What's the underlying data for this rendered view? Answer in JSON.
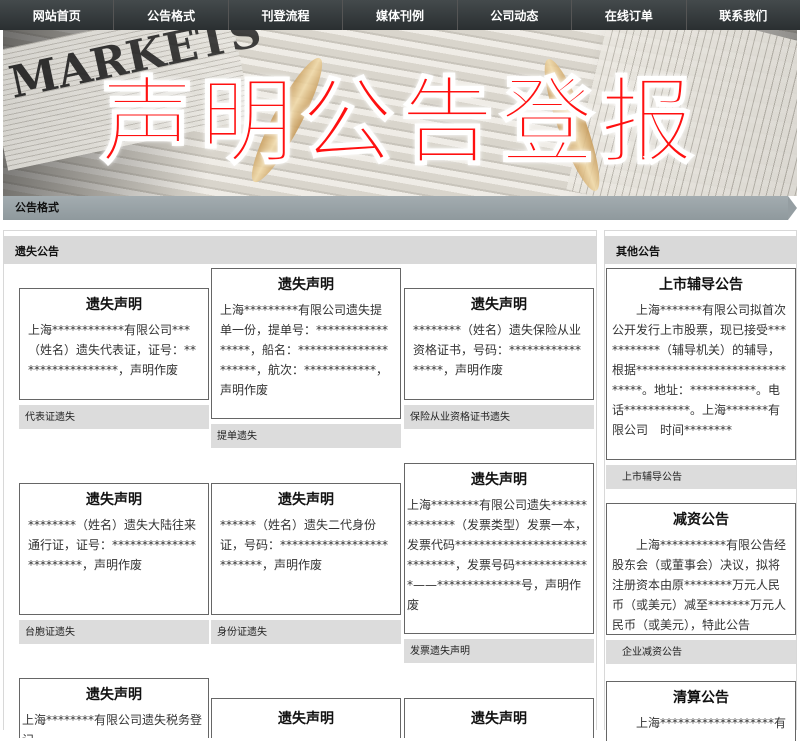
{
  "nav": [
    "网站首页",
    "公告格式",
    "刊登流程",
    "媒体刊例",
    "公司动态",
    "在线订单",
    "联系我们"
  ],
  "banner": {
    "title": "声明公告登报",
    "bg_word": "MARKETS"
  },
  "breadcrumb": "公告格式",
  "main": {
    "header": "遗失公告",
    "cards": [
      {
        "title": "遗失声明",
        "body": "上海************有限公司***（姓名）遗失代表证，证号：*****************，声明作废",
        "caption": "代表证遗失"
      },
      {
        "title": "遗失声明",
        "body": "上海*********有限公司遗失提单一份，提单号：*****************，船名：*********************，航次：************，声明作废",
        "caption": "提单遗失"
      },
      {
        "title": "遗失声明",
        "body": "********（姓名）遗失保险从业资格证书，号码：*****************，声明作废",
        "caption": "保险从业资格证书遗失"
      },
      {
        "title": "遗失声明",
        "body": "********（姓名）遗失大陆往来通行证，证号：***********************，声明作废",
        "caption": "台胞证遗失"
      },
      {
        "title": "遗失声明",
        "body": "******（姓名）遗失二代身份证，号码：*************************，声明作废",
        "caption": "身份证遗失"
      },
      {
        "title": "遗失声明",
        "body": "上海********有限公司遗失**************（发票类型）发票一本，发票代码******************************，发票号码*************——**************号，声明作废",
        "caption": "发票遗失声明"
      },
      {
        "title": "遗失声明",
        "body": "上海********有限公司遗失税务登记",
        "caption": ""
      },
      {
        "title": "遗失声明",
        "body": "",
        "caption": ""
      },
      {
        "title": "遗失声明",
        "body": "",
        "caption": ""
      }
    ]
  },
  "side": {
    "header": "其他公告",
    "cards": [
      {
        "title": "上市辅导公告",
        "body": "上海*******有限公司拟首次公开发行上市股票，现已接受***********（辅导机关）的辅导，根据******************************。地址：***********。电话***********。上海*******有限公司　时间********",
        "caption": "上市辅导公告"
      },
      {
        "title": "减资公告",
        "body": "上海***********有限公告经股东会（或董事会）决议，拟将注册资本由原********万元人民币（或美元）减至*******万元人民币（或美元），特此公告",
        "caption": "企业减资公告"
      },
      {
        "title": "清算公告",
        "body": "上海*******************有",
        "caption": ""
      }
    ]
  }
}
